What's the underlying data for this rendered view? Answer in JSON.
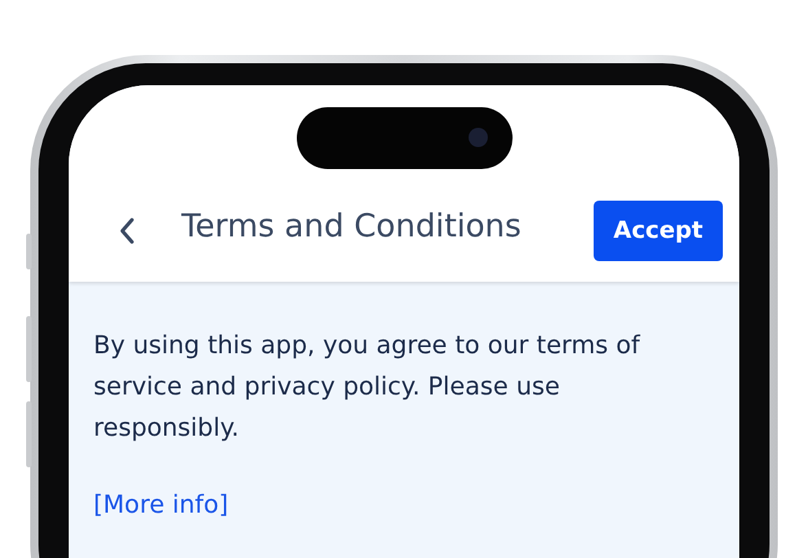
{
  "header": {
    "title": "Terms and Conditions",
    "accept_button": "Accept"
  },
  "body": {
    "paragraph": "By using this app, you agree to our terms of service and privacy policy. Please use responsibly.",
    "link": "[More info]"
  }
}
